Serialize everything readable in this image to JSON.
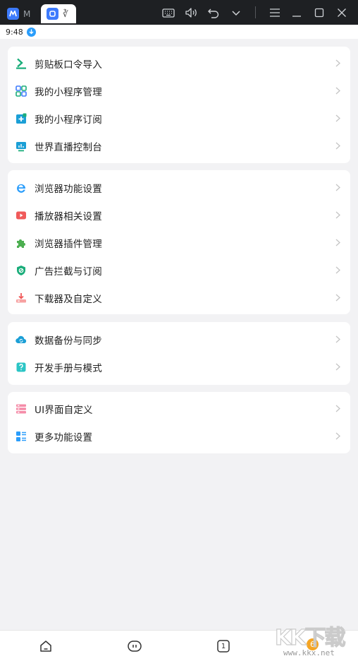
{
  "titlebar": {
    "tab1_label": "M",
    "tab2_label": "∛",
    "icons": [
      "keyboard-icon",
      "volume-icon",
      "undo-icon",
      "chevron-down-icon",
      "menu-icon",
      "minimize-icon",
      "maximize-icon",
      "close-icon"
    ]
  },
  "statusbar": {
    "time": "9:48"
  },
  "groups": [
    {
      "items": [
        {
          "label": "剪贴板口令导入",
          "icon": "import-icon"
        },
        {
          "label": "我的小程序管理",
          "icon": "apps-grid-icon"
        },
        {
          "label": "我的小程序订阅",
          "icon": "add-subscribe-icon"
        },
        {
          "label": "世界直播控制台",
          "icon": "live-console-icon"
        }
      ]
    },
    {
      "items": [
        {
          "label": "浏览器功能设置",
          "icon": "browser-e-icon"
        },
        {
          "label": "播放器相关设置",
          "icon": "player-icon"
        },
        {
          "label": "浏览器插件管理",
          "icon": "plugin-puzzle-icon"
        },
        {
          "label": "广告拦截与订阅",
          "icon": "shield-icon"
        },
        {
          "label": "下载器及自定义",
          "icon": "download-icon"
        }
      ]
    },
    {
      "items": [
        {
          "label": "数据备份与同步",
          "icon": "cloud-sync-icon"
        },
        {
          "label": "开发手册与模式",
          "icon": "help-book-icon"
        }
      ]
    },
    {
      "items": [
        {
          "label": "UI界面自定义",
          "icon": "ui-layout-icon"
        },
        {
          "label": "更多功能设置",
          "icon": "more-settings-icon"
        }
      ]
    }
  ],
  "bottom_nav": {
    "tabs_count": "1",
    "badge": "6"
  },
  "watermark": {
    "logo": "KK下载",
    "url": "www.kkx.net"
  },
  "colors": {
    "accent_blue": "#3d7bfd",
    "green": "#1aad7a",
    "red": "#f05a5a",
    "badge": "#f5a524"
  }
}
